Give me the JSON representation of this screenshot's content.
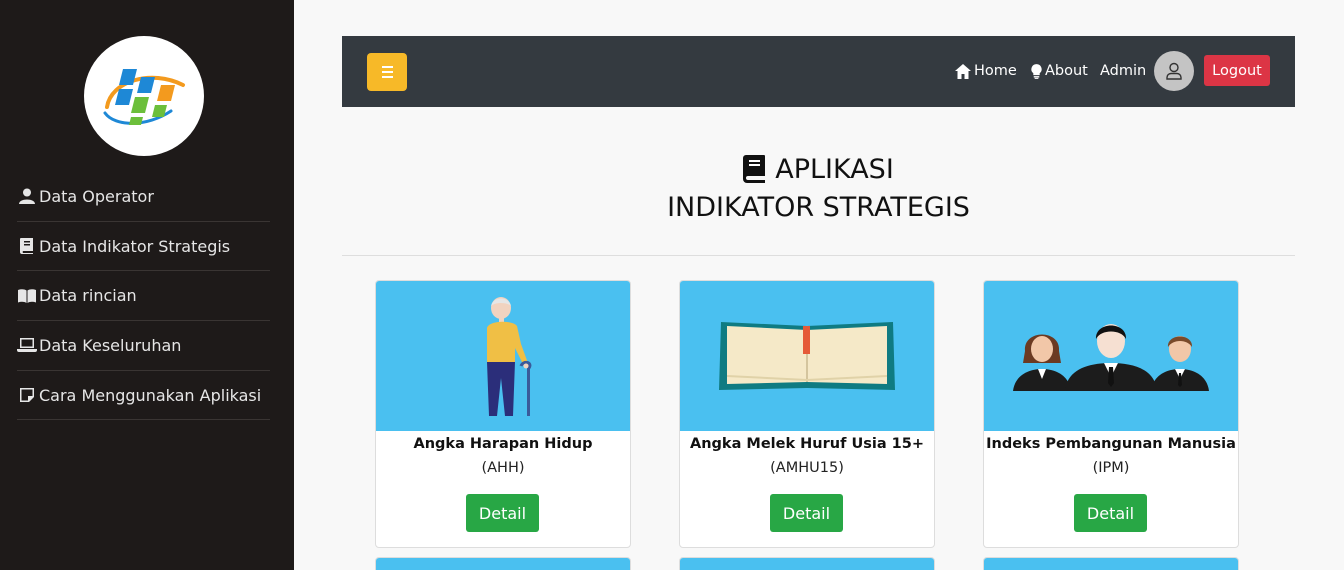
{
  "sidebar": {
    "items": [
      {
        "label": "Data Operator",
        "icon": "user-icon"
      },
      {
        "label": "Data Indikator Strategis",
        "icon": "book-icon"
      },
      {
        "label": "Data rincian",
        "icon": "open-book-icon"
      },
      {
        "label": "Data Keseluruhan",
        "icon": "laptop-icon"
      },
      {
        "label": "Cara Menggunakan Aplikasi",
        "icon": "edit-icon"
      }
    ]
  },
  "navbar": {
    "home_label": "Home",
    "about_label": "About",
    "admin_label": "Admin",
    "logout_label": "Logout"
  },
  "header": {
    "title_line1": "APLIKASI",
    "title_line2": "INDIKATOR STRATEGIS"
  },
  "cards": [
    {
      "title": "Angka Harapan Hidup",
      "abbr": "(AHH)",
      "button": "Detail",
      "image": "elderly-person"
    },
    {
      "title": "Angka Melek Huruf Usia 15+",
      "abbr": "(AMHU15)",
      "button": "Detail",
      "image": "open-book"
    },
    {
      "title": "Indeks Pembangunan Manusia",
      "abbr": "(IPM)",
      "button": "Detail",
      "image": "people-group"
    }
  ],
  "colors": {
    "sidebar_bg": "#1e1a19",
    "navbar_bg": "#343a40",
    "toggle": "#f7b928",
    "logout": "#dc3545",
    "detail": "#28a745",
    "card_image_bg": "#4ac0f0"
  }
}
